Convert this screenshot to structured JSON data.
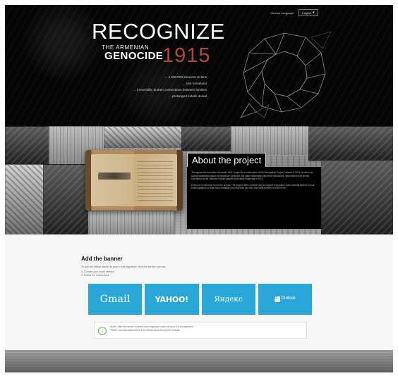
{
  "header": {
    "language_label": "Choose Language:",
    "language_selected": "English"
  },
  "hero": {
    "title_main": "RECOGNIZE",
    "title_sub": "THE ARMENIAN",
    "title_genocide": "GENOCIDE",
    "title_year": "1915",
    "taglines": [
      "... 1.500.000 innocent victims",
      "... lost homeland",
      "... irreversibly broken connections between families",
      "... prolonged turkish denial"
    ]
  },
  "about": {
    "title": "About the project",
    "paragraphs": [
      "“Recognize the Armenian Genocide 1915” project is a continuation of the Recognition Project initiated in 2014. Its aim is to spread awareness about the Armenian Genocide and share information about the massacres, deportations and crimes committed by the Ottoman Empire against Armenians beginning in 1915.",
      "Everyone is welcome to join the project. The project offers a simple way to support recognition: add a special banner to your email signature so that every message you send tells the story and invites others to learn more."
    ]
  },
  "banner": {
    "title": "Add the banner",
    "description": "To add the official banner to your e-mail signature, click the service you use.",
    "steps": [
      "1. Choose your email service",
      "2. Follow the instructions"
    ],
    "services": [
      {
        "label": "Gmail",
        "icon": "gmail-logo"
      },
      {
        "label": "YAHOO!",
        "icon": "yahoo-logo"
      },
      {
        "label": "Яндекс",
        "icon": "yandex-logo"
      },
      {
        "label": "Outlook",
        "icon": "outlook-logo"
      }
    ],
    "notice_lines": [
      "Notice: After the banner is added, your outgoing e-mails will show it in the signature.",
      "Please, use instructions below if the banner does not appear correctly."
    ]
  },
  "colors": {
    "accent_red": "#b4453f",
    "banner_blue": "#2aa7d9",
    "notice_green": "#62b44a"
  }
}
